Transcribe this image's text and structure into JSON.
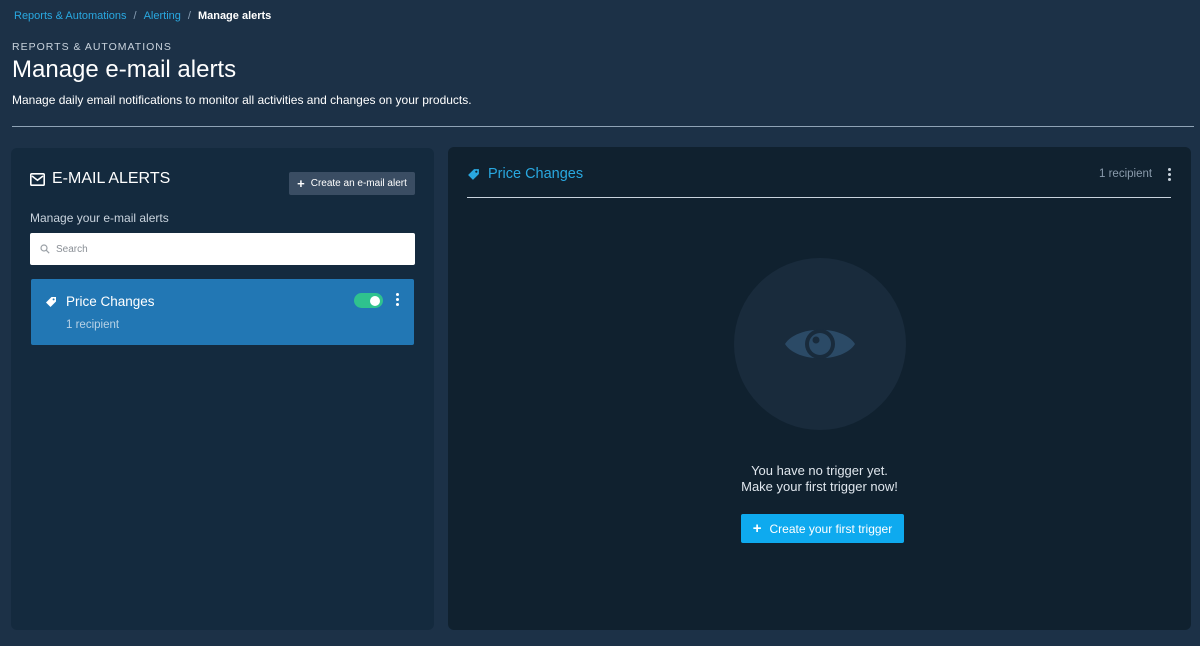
{
  "breadcrumb": {
    "items": [
      "Reports & Automations",
      "Alerting"
    ],
    "current": "Manage alerts",
    "separator": "/"
  },
  "header": {
    "eyebrow": "REPORTS & AUTOMATIONS",
    "title": "Manage e-mail alerts",
    "subtitle": "Manage daily email notifications to monitor all activities and changes on your products."
  },
  "alerts_panel": {
    "title": "E-MAIL ALERTS",
    "title_icon": "envelope-icon",
    "create_button_label": "Create an e-mail alert",
    "subtitle": "Manage your e-mail alerts",
    "search_placeholder": "Search",
    "search_value": "",
    "items": [
      {
        "icon": "price-tag-icon",
        "title": "Price Changes",
        "recipients": "1 recipient",
        "enabled": true
      }
    ]
  },
  "detail_panel": {
    "icon": "price-tag-icon",
    "title": "Price Changes",
    "recipients": "1 recipient",
    "empty_icon": "eye-icon",
    "empty_line1": "You have no trigger yet.",
    "empty_line2": "Make your first trigger now!",
    "create_trigger_label": "Create your first trigger"
  },
  "colors": {
    "background": "#1c3147",
    "panel": "#142a3e",
    "detail_panel": "#10212f",
    "accent": "#29a8e0",
    "selected_item": "#2277b4",
    "toggle_on": "#2fc28e",
    "primary_button": "#0eaaef"
  }
}
